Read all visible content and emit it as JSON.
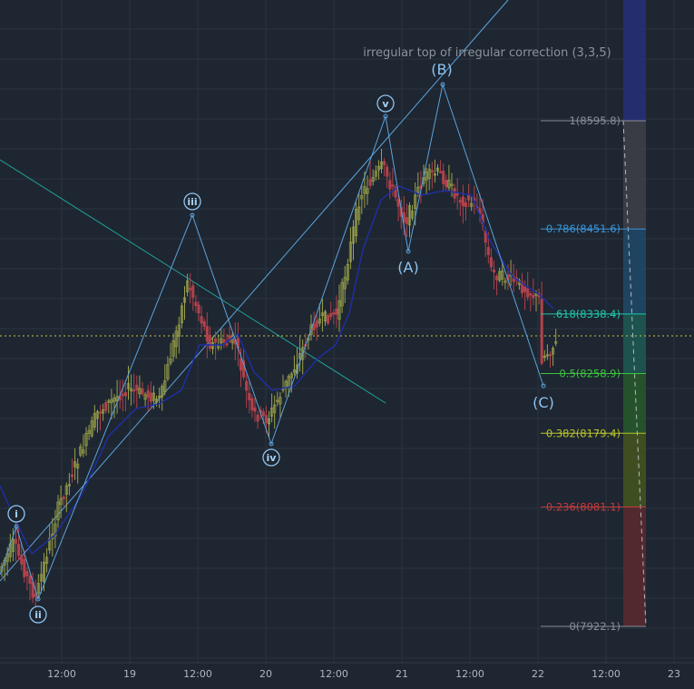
{
  "chart_data": {
    "type": "candlestick",
    "title": "irregular top of irregular correction (3,3,5)",
    "x_ticks": [
      "12:00",
      "19",
      "12:00",
      "20",
      "12:00",
      "21",
      "12:00",
      "22",
      "12:00",
      "23"
    ],
    "fib_levels": [
      {
        "label": "1(8595.8)",
        "ratio": 1,
        "price": 8595.8,
        "color": "#8a8f96"
      },
      {
        "label": "0.786(8451.6)",
        "ratio": 0.786,
        "price": 8451.6,
        "color": "#3a94d8"
      },
      {
        "label": ".618(8338.4)",
        "ratio": 0.618,
        "price": 8338.4,
        "color": "#21c7a8"
      },
      {
        "label": "0.5(8258.9)",
        "ratio": 0.5,
        "price": 8258.9,
        "color": "#3cc23c"
      },
      {
        "label": "0.382(8179.4)",
        "ratio": 0.382,
        "price": 8179.4,
        "color": "#b7c32b"
      },
      {
        "label": "0.236(8081.1)",
        "ratio": 0.236,
        "price": 8081.1,
        "color": "#c43b3b"
      },
      {
        "label": "0(7922.1)",
        "ratio": 0,
        "price": 7922.1,
        "color": "#8a8f96"
      }
    ],
    "wave_labels": [
      {
        "text": "i",
        "circled": true
      },
      {
        "text": "ii",
        "circled": true
      },
      {
        "text": "iii",
        "circled": true
      },
      {
        "text": "iv",
        "circled": true
      },
      {
        "text": "v",
        "circled": true
      },
      {
        "text": "(A)",
        "circled": false
      },
      {
        "text": "(B)",
        "circled": false
      },
      {
        "text": "(C)",
        "circled": false
      }
    ],
    "colors": {
      "background": "#1e2631",
      "grid": "#2b3440",
      "up_candle": "#9aa24a",
      "down_candle": "#b0424c",
      "wave_line": "#5ca3db",
      "trend_line": "#1fa39a",
      "moving_average": "#1e2fa8",
      "price_line": "#c7c44a",
      "axis_text": "#b2b5be"
    }
  }
}
